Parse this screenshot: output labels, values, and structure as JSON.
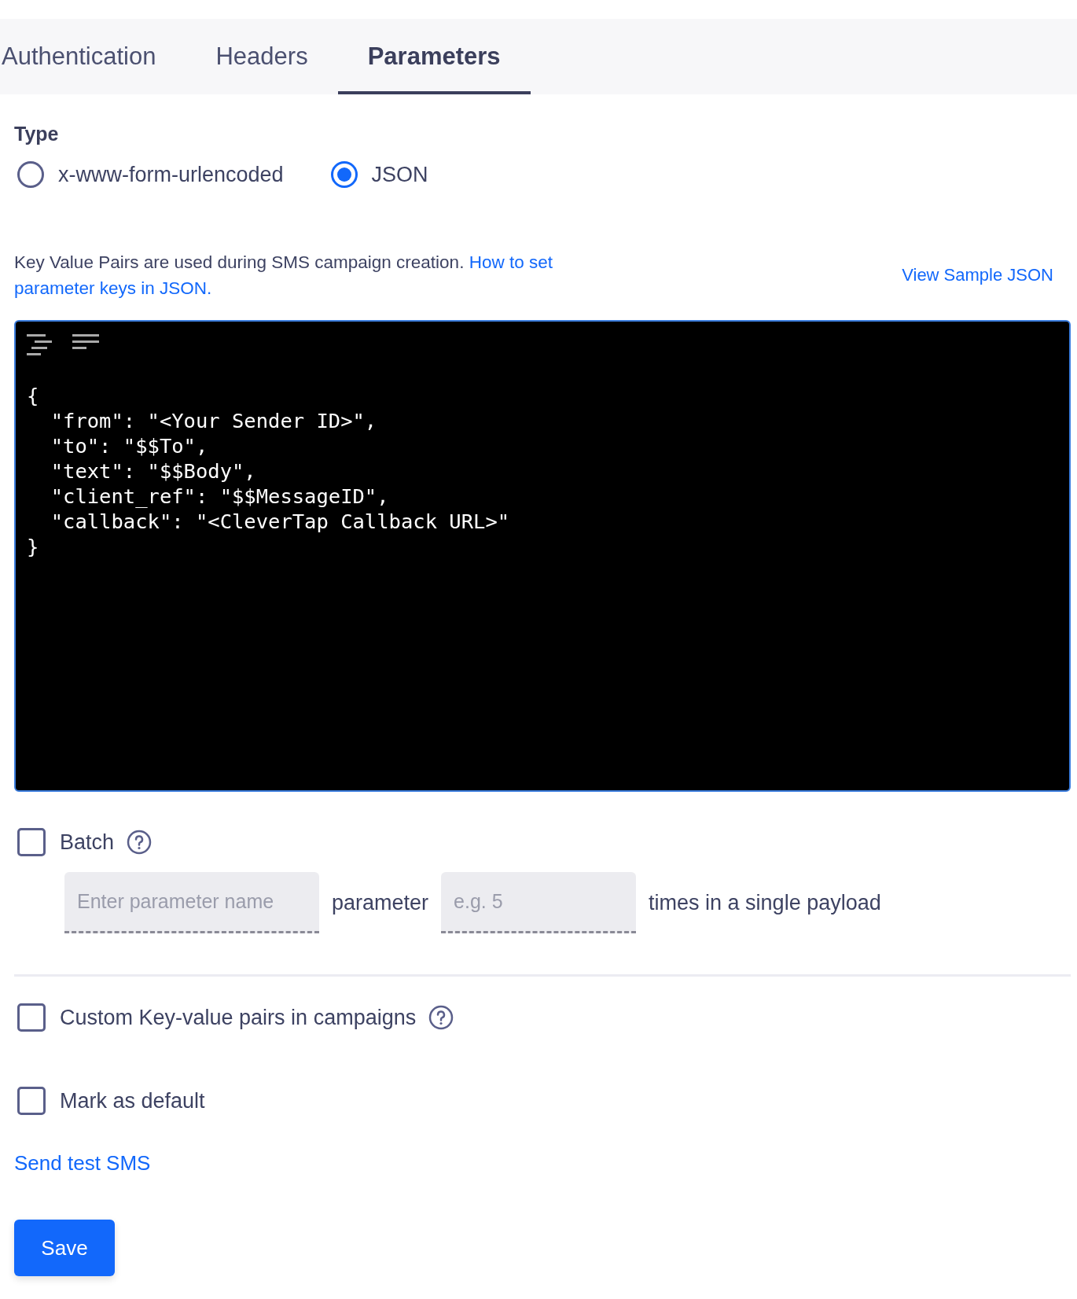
{
  "tabs": [
    {
      "label": "Authentication",
      "selected": false
    },
    {
      "label": "Headers",
      "selected": false
    },
    {
      "label": "Parameters",
      "selected": true
    }
  ],
  "type": {
    "label": "Type",
    "options": [
      {
        "label": "x-www-form-urlencoded",
        "selected": false
      },
      {
        "label": "JSON",
        "selected": true
      }
    ]
  },
  "description": {
    "text": "Key Value Pairs are used during SMS campaign creation.",
    "link_lines": [
      "How to set",
      "parameter keys in JSON."
    ]
  },
  "sample_link": "View Sample JSON",
  "editor": {
    "lines": [
      "{",
      "  \"from\": \"<Your Sender ID>\",",
      "  \"to\": \"$$To\",",
      "  \"text\": \"$$Body\",",
      "  \"client_ref\": \"$$MessageID\",",
      "  \"callback\": \"<CleverTap Callback URL>\"",
      "}"
    ]
  },
  "batch": {
    "label": "Batch",
    "checked": false,
    "name_placeholder": "Enter parameter name",
    "middle_text": "parameter",
    "count_placeholder": "e.g. 5",
    "end_text": "times in a single payload"
  },
  "options": [
    {
      "label": "Custom Key-value pairs in campaigns",
      "checked": false,
      "help": true
    },
    {
      "label": "Mark as default",
      "checked": false,
      "help": false
    }
  ],
  "send_test_link": "Send test SMS",
  "save_button": "Save"
}
